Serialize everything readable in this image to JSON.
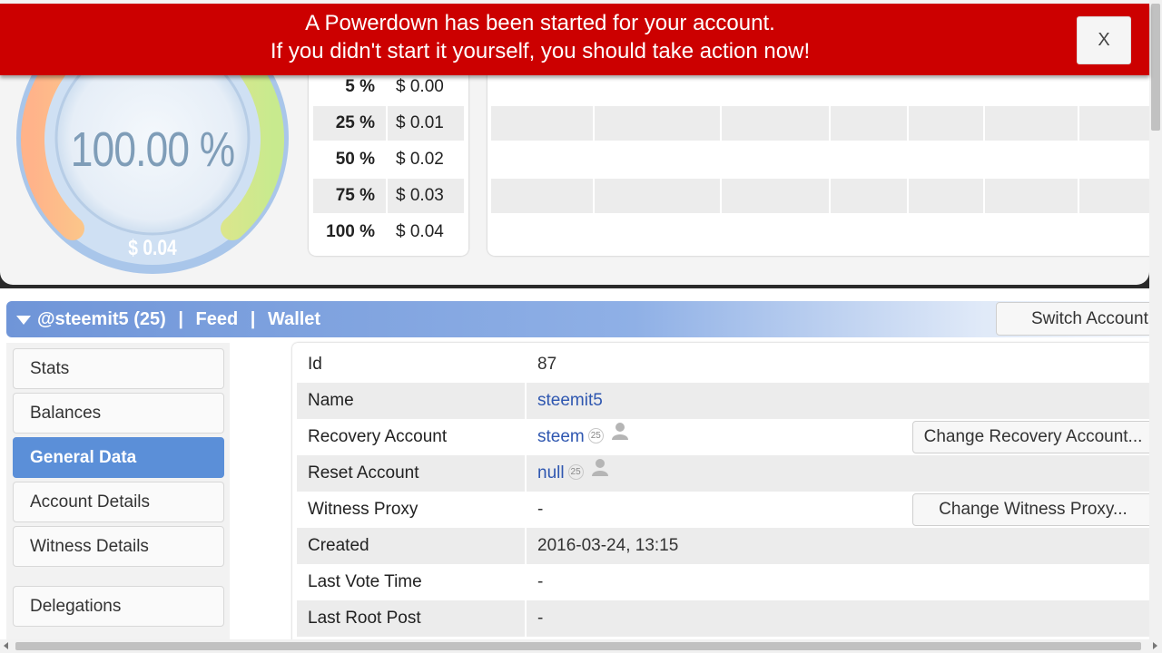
{
  "banner": {
    "line1": "A Powerdown has been started for your account.",
    "line2": "If you didn't start it yourself, you should take action now!",
    "close_label": "X",
    "color": "#cc0000"
  },
  "gauge": {
    "percent_label": "100.00 %",
    "money_label": "$ 0.04",
    "percent_value": 100
  },
  "vote_table": {
    "rows": [
      {
        "pct": "5 %",
        "value": "$ 0.00"
      },
      {
        "pct": "25 %",
        "value": "$ 0.01"
      },
      {
        "pct": "50 %",
        "value": "$ 0.02"
      },
      {
        "pct": "75 %",
        "value": "$ 0.03"
      },
      {
        "pct": "100 %",
        "value": "$ 0.04"
      }
    ]
  },
  "account_bar": {
    "account": "@steemit5 (25)",
    "separator": "|",
    "feed": "Feed",
    "wallet": "Wallet",
    "switch_label": "Switch Account"
  },
  "sidebar": {
    "items": [
      {
        "label": "Stats"
      },
      {
        "label": "Balances"
      },
      {
        "label": "General Data",
        "active": true
      },
      {
        "label": "Account Details"
      },
      {
        "label": "Witness Details"
      },
      {
        "label": "Delegations"
      }
    ]
  },
  "general_data": {
    "rows": [
      {
        "key": "Id",
        "value": "87"
      },
      {
        "key": "Name",
        "value": "steemit5"
      },
      {
        "key": "Recovery Account",
        "value": "steem",
        "badge": "25",
        "button": "Change Recovery Account..."
      },
      {
        "key": "Reset Account",
        "value": "null",
        "badge": "25"
      },
      {
        "key": "Witness Proxy",
        "value": "-",
        "button": "Change Witness Proxy..."
      },
      {
        "key": "Created",
        "value": "2016-03-24, 13:15"
      },
      {
        "key": "Last Vote Time",
        "value": "-"
      },
      {
        "key": "Last Root Post",
        "value": "-"
      }
    ]
  },
  "colors": {
    "accent": "#5b8fd8",
    "link": "#2f57b0"
  }
}
